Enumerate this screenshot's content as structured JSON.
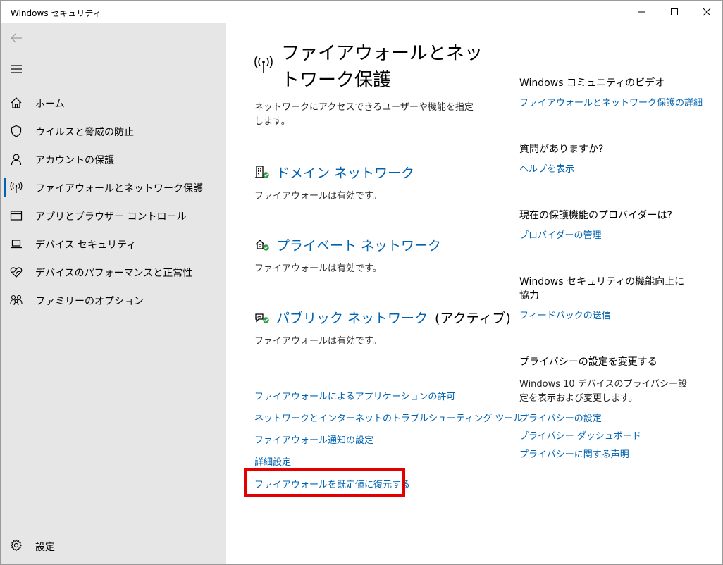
{
  "window": {
    "title": "Windows セキュリティ"
  },
  "sidebar": {
    "items": [
      {
        "label": "ホーム",
        "icon": "home-icon"
      },
      {
        "label": "ウイルスと脅威の防止",
        "icon": "shield-icon"
      },
      {
        "label": "アカウントの保護",
        "icon": "person-icon"
      },
      {
        "label": "ファイアウォールとネットワーク保護",
        "icon": "wifi-antenna-icon",
        "active": true
      },
      {
        "label": "アプリとブラウザー コントロール",
        "icon": "app-window-icon"
      },
      {
        "label": "デバイス セキュリティ",
        "icon": "laptop-icon"
      },
      {
        "label": "デバイスのパフォーマンスと正常性",
        "icon": "heart-pulse-icon"
      },
      {
        "label": "ファミリーのオプション",
        "icon": "family-icon"
      }
    ],
    "settings_label": "設定"
  },
  "main": {
    "title": "ファイアウォールとネットワーク保護",
    "description": "ネットワークにアクセスできるユーザーや機能を指定します。",
    "networks": [
      {
        "name": "ドメイン ネットワーク",
        "status": "ファイアウォールは有効です。",
        "suffix": ""
      },
      {
        "name": "プライベート ネットワーク",
        "status": "ファイアウォールは有効です。",
        "suffix": ""
      },
      {
        "name": "パブリック ネットワーク",
        "status": "ファイアウォールは有効です。",
        "suffix": "(アクティブ)"
      }
    ],
    "links": [
      "ファイアウォールによるアプリケーションの許可",
      "ネットワークとインターネットのトラブルシューティング ツール",
      "ファイアウォール通知の設定",
      "詳細設定",
      "ファイアウォールを既定値に復元する"
    ]
  },
  "right": {
    "video_head": "Windows コミュニティのビデオ",
    "video_link": "ファイアウォールとネットワーク保護の詳細",
    "question_head": "質問がありますか?",
    "question_link": "ヘルプを表示",
    "provider_head": "現在の保護機能のプロバイダーは?",
    "provider_link": "プロバイダーの管理",
    "feedback_head": "Windows セキュリティの機能向上に協力",
    "feedback_link": "フィードバックの送信",
    "privacy_head": "プライバシーの設定を変更する",
    "privacy_text": "Windows 10 デバイスのプライバシー設定を表示および変更します。",
    "privacy_links": [
      "プライバシーの設定",
      "プライバシー ダッシュボード",
      "プライバシーに関する声明"
    ]
  },
  "colors": {
    "accent": "#0063b1",
    "highlight": "#e40000",
    "ok": "#2e9c3f",
    "sidebar": "#e6e6e6"
  }
}
